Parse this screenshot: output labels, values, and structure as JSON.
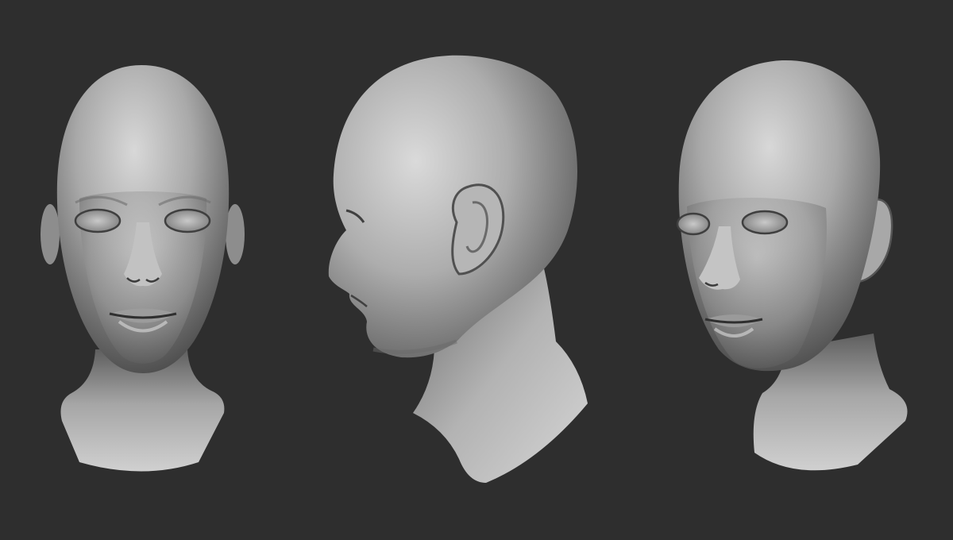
{
  "scene": {
    "background_color": "#2e2e2e",
    "material_color": "#b9b9b9",
    "views": [
      {
        "name": "front-view"
      },
      {
        "name": "side-view"
      },
      {
        "name": "three-quarter-view"
      }
    ]
  }
}
